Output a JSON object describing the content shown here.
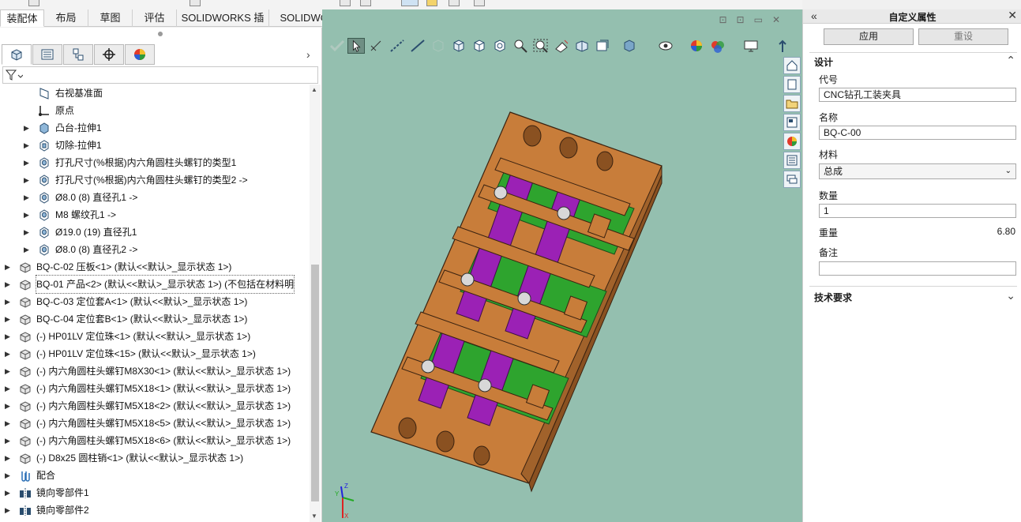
{
  "tabs": [
    "装配体",
    "布局",
    "草图",
    "评估",
    "SOLIDWORKS 插件",
    "SOLIDWORKS MBD"
  ],
  "feature_tree": {
    "items": [
      {
        "label": "右视基准面",
        "icon": "plane-icon",
        "caret": false,
        "level": 2
      },
      {
        "label": "原点",
        "icon": "origin-icon",
        "caret": false,
        "level": 2
      },
      {
        "label": "凸台-拉伸1",
        "icon": "extrude-boss-icon",
        "caret": true,
        "level": 2
      },
      {
        "label": "切除-拉伸1",
        "icon": "extrude-cut-icon",
        "caret": true,
        "level": 2
      },
      {
        "label": "打孔尺寸(%根据)内六角圆柱头螺钉的类型1",
        "icon": "hole-wizard-icon",
        "caret": true,
        "level": 2
      },
      {
        "label": "打孔尺寸(%根据)内六角圆柱头螺钉的类型2 ->",
        "icon": "hole-wizard-icon",
        "caret": true,
        "level": 2
      },
      {
        "label": "Ø8.0 (8) 直径孔1 ->",
        "icon": "hole-wizard-icon",
        "caret": true,
        "level": 2
      },
      {
        "label": "M8 螺纹孔1 ->",
        "icon": "hole-wizard-icon",
        "caret": true,
        "level": 2
      },
      {
        "label": "Ø19.0 (19) 直径孔1",
        "icon": "hole-wizard-icon",
        "caret": true,
        "level": 2
      },
      {
        "label": "Ø8.0 (8) 直径孔2 ->",
        "icon": "hole-wizard-icon",
        "caret": true,
        "level": 2
      },
      {
        "label": "BQ-C-02 压板<1> (默认<<默认>_显示状态 1>)",
        "icon": "part-icon",
        "caret": true,
        "level": 1
      },
      {
        "label": "BQ-01 产品<2> (默认<<默认>_显示状态 1>) (不包括在材料明",
        "icon": "part-icon",
        "caret": true,
        "level": 1,
        "selected": true
      },
      {
        "label": "BQ-C-03 定位套A<1> (默认<<默认>_显示状态 1>)",
        "icon": "part-icon",
        "caret": true,
        "level": 1
      },
      {
        "label": "BQ-C-04 定位套B<1> (默认<<默认>_显示状态 1>)",
        "icon": "part-icon",
        "caret": true,
        "level": 1
      },
      {
        "label": "(-) HP01LV 定位珠<1> (默认<<默认>_显示状态 1>)",
        "icon": "part-icon",
        "caret": true,
        "level": 1
      },
      {
        "label": "(-) HP01LV 定位珠<15> (默认<<默认>_显示状态 1>)",
        "icon": "part-icon",
        "caret": true,
        "level": 1
      },
      {
        "label": "(-) 内六角圆柱头螺钉M8X30<1> (默认<<默认>_显示状态 1>)",
        "icon": "part-icon",
        "caret": true,
        "level": 1
      },
      {
        "label": "(-) 内六角圆柱头螺钉M5X18<1> (默认<<默认>_显示状态 1>)",
        "icon": "part-icon",
        "caret": true,
        "level": 1
      },
      {
        "label": "(-) 内六角圆柱头螺钉M5X18<2> (默认<<默认>_显示状态 1>)",
        "icon": "part-icon",
        "caret": true,
        "level": 1
      },
      {
        "label": "(-) 内六角圆柱头螺钉M5X18<5> (默认<<默认>_显示状态 1>)",
        "icon": "part-icon",
        "caret": true,
        "level": 1
      },
      {
        "label": "(-) 内六角圆柱头螺钉M5X18<6> (默认<<默认>_显示状态 1>)",
        "icon": "part-icon",
        "caret": true,
        "level": 1
      },
      {
        "label": "(-) D8x25 圆柱销<1> (默认<<默认>_显示状态 1>)",
        "icon": "part-icon",
        "caret": true,
        "level": 1
      },
      {
        "label": "配合",
        "icon": "mates-icon",
        "caret": true,
        "level": 1
      },
      {
        "label": "镜向零部件1",
        "icon": "mirror-component-icon",
        "caret": true,
        "level": 1
      },
      {
        "label": "镜向零部件2",
        "icon": "mirror-component-icon",
        "caret": true,
        "level": 1
      }
    ]
  },
  "property_panel": {
    "title": "自定义属性",
    "apply_label": "应用",
    "reset_label": "重设",
    "section_design": "设计",
    "code_label": "代号",
    "code_value": "CNC钻孔工装夹具",
    "name_label": "名称",
    "name_value": "BQ-C-00",
    "material_label": "材料",
    "material_value": "总成",
    "qty_label": "数量",
    "qty_value": "1",
    "weight_label": "重量",
    "weight_value": "6.80",
    "remark_label": "备注",
    "remark_value": "",
    "section_tech": "技术要求"
  },
  "colors": {
    "viewport_bg": "#94bfaf",
    "base_plate": "#c87d3a",
    "clamp": "#9b21b5",
    "locator": "#2ea42e"
  }
}
